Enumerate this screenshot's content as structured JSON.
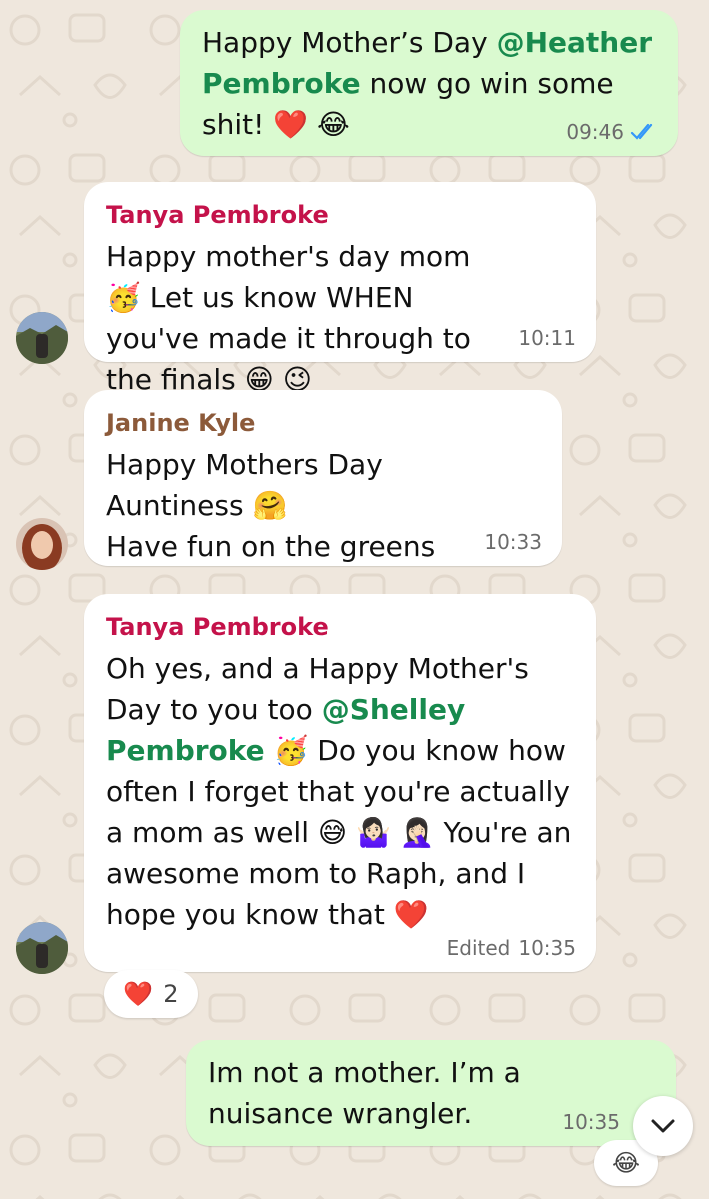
{
  "messages": [
    {
      "id": "m1",
      "direction": "outgoing",
      "text_before": "Happy Mother’s Day ",
      "mention": "@Heather Pembroke",
      "text_after": " now go win some shit! ❤️ 😂",
      "time": "09:46",
      "status_icon": "double-check-read-icon"
    },
    {
      "id": "m2",
      "direction": "incoming",
      "sender": "Tanya Pembroke",
      "text": "Happy mother's day mom 🥳 Let us know WHEN you've made it through to the finals 😁 😉",
      "time": "10:11"
    },
    {
      "id": "m3",
      "direction": "incoming",
      "sender": "Janine Kyle",
      "text": "Happy Mothers Day Auntiness 🤗",
      "text_line2": "Have fun on the greens",
      "time": "10:33"
    },
    {
      "id": "m4",
      "direction": "incoming",
      "sender": "Tanya Pembroke",
      "text_before": "Oh yes, and a Happy Mother's Day to you too ",
      "mention": "@Shelley Pembroke",
      "text_after": " 🥳 Do you know how often I forget that you're actually a mom as well 😅 🤷🏻‍♀️ 🤦🏻‍♀️ You're an awesome mom to Raph, and I hope you know that ❤️",
      "edited_label": "Edited",
      "time": "10:35",
      "reaction": {
        "emoji": "❤️",
        "count": "2"
      }
    },
    {
      "id": "m5",
      "direction": "outgoing",
      "text": "Im not a mother. I’m a nuisance wrangler.",
      "time": "10:35",
      "reaction": {
        "emoji": "😂"
      }
    }
  ],
  "controls": {
    "scroll_down_icon": "chevron-down-icon"
  },
  "colors": {
    "outgoing_bubble": "#dafad0",
    "incoming_bubble": "#ffffff",
    "mention": "#188a4e",
    "tanya_name": "#c4124a",
    "janine_name": "#8c5a3a",
    "read_ticks": "#3497f9",
    "wallpaper": "#efe7dd"
  }
}
